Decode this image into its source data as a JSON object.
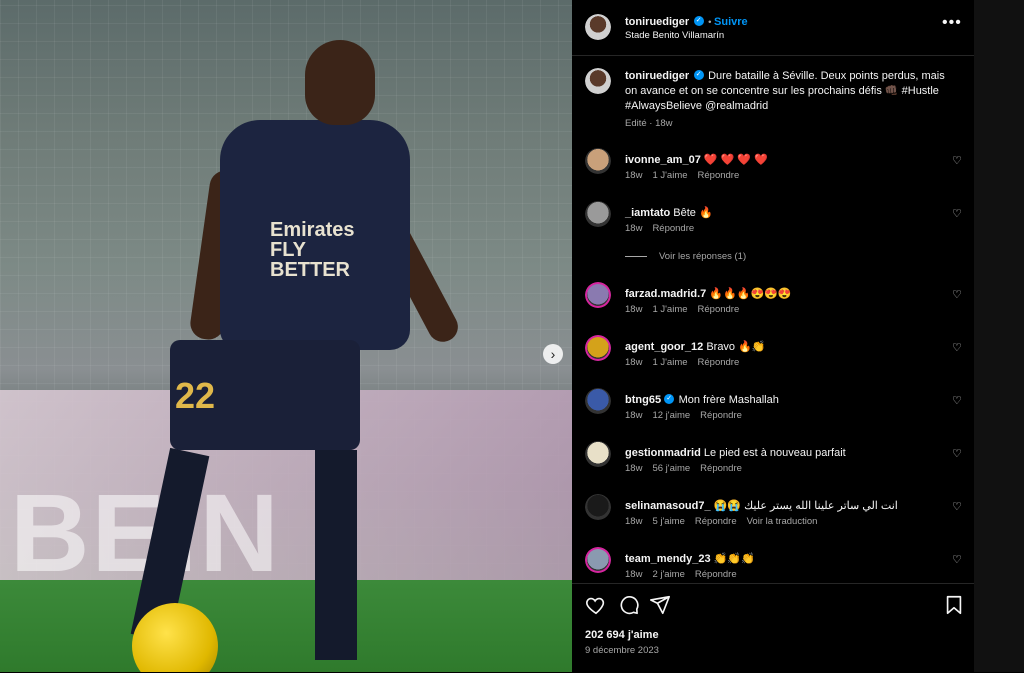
{
  "post": {
    "author": "toniruediger",
    "follow_label": "Suivre",
    "location": "Stade Benito Villamarín",
    "more_label": "•••",
    "caption": "Dure bataille à Séville. Deux points perdus, mais on avance et on se concentre sur les prochains défis 👊🏿 #Hustle #AlwaysBelieve @realmadrid",
    "caption_meta": "Edité · 18w",
    "likes": "202 694 j'aime",
    "date": "9 décembre 2023"
  },
  "photo": {
    "jersey_text": "Emirates FLY BETTER",
    "shorts_number": "22",
    "banner_text": "BEIN",
    "next_icon": "›"
  },
  "comments": [
    {
      "user": "ivonne_am_07",
      "text": "❤️ ❤️ ❤️ ❤️",
      "age": "18w",
      "likes": "1 J'aime",
      "reply": "Répondre",
      "avatar_color": "#c9a07a",
      "verified": false
    },
    {
      "user": "_iamtato",
      "text": "Bête 🔥",
      "age": "18w",
      "likes": "",
      "reply": "Répondre",
      "avatar_color": "#9a9a9a",
      "verified": false,
      "view_replies": "Voir les réponses (1)"
    },
    {
      "user": "farzad.madrid.7",
      "text": "🔥🔥🔥😍😍😍",
      "age": "18w",
      "likes": "1 J'aime",
      "reply": "Répondre",
      "avatar_color": "#8a7ab0",
      "verified": false
    },
    {
      "user": "agent_goor_12",
      "text": "Bravo 🔥👏",
      "age": "18w",
      "likes": "1 J'aime",
      "reply": "Répondre",
      "avatar_color": "#d4a21a",
      "verified": false
    },
    {
      "user": "btng65",
      "text": "Mon frère Mashallah",
      "age": "18w",
      "likes": "12 j'aime",
      "reply": "Répondre",
      "avatar_color": "#3a5aa8",
      "verified": true
    },
    {
      "user": "gestionmadrid",
      "text": "Le pied est à nouveau parfait",
      "age": "18w",
      "likes": "56 j'aime",
      "reply": "Répondre",
      "avatar_color": "#e8e0c8",
      "verified": false
    },
    {
      "user": "selinamasoud7_",
      "text": "😭😭 انت الي ساتر علينا الله يستر عليك",
      "age": "18w",
      "likes": "5 j'aime",
      "reply": "Répondre",
      "avatar_color": "#1a1a1a",
      "verified": false,
      "translate": "Voir la traduction"
    },
    {
      "user": "team_mendy_23",
      "text": "👏👏👏",
      "age": "18w",
      "likes": "2 j'aime",
      "reply": "Répondre",
      "avatar_color": "#8a9ab0",
      "verified": false
    }
  ],
  "icons": {
    "like": "heart-icon",
    "comment": "comment-icon",
    "share": "share-icon",
    "save": "bookmark-icon"
  },
  "colors": {
    "accent": "#0095f6",
    "background": "#000000",
    "muted": "#a8a8a8"
  }
}
